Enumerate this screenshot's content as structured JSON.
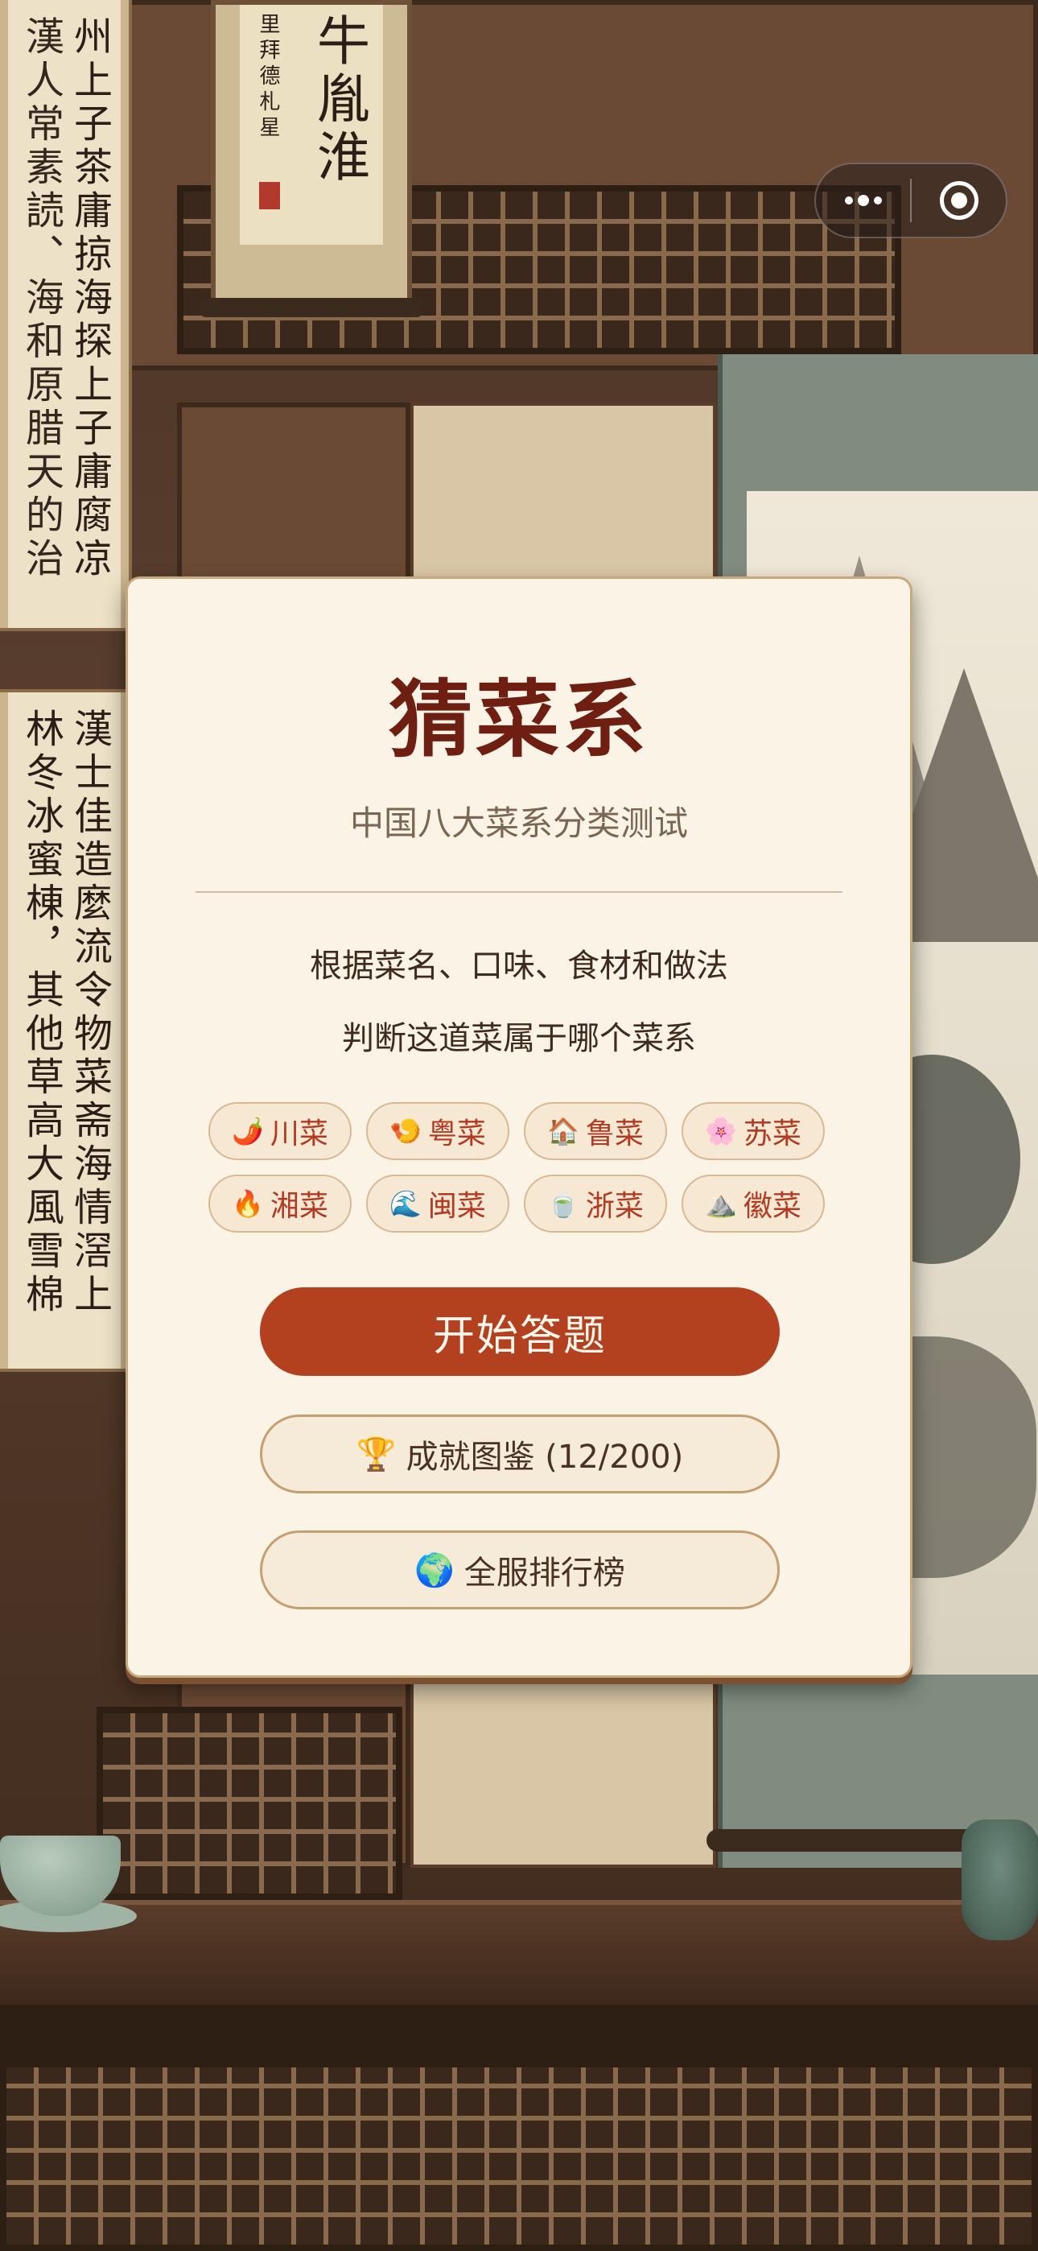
{
  "app": {
    "title": "猜菜系",
    "subtitle": "中国八大菜系分类测试"
  },
  "description": {
    "line1": "根据菜名、口味、食材和做法",
    "line2": "判断这道菜属于哪个菜系"
  },
  "cuisines": [
    {
      "icon": "🌶️",
      "icon_name": "chili-icon",
      "label": "川菜"
    },
    {
      "icon": "🍤",
      "icon_name": "shrimp-icon",
      "label": "粤菜"
    },
    {
      "icon": "🏠",
      "icon_name": "house-icon",
      "label": "鲁菜"
    },
    {
      "icon": "🌸",
      "icon_name": "blossom-icon",
      "label": "苏菜"
    },
    {
      "icon": "🔥",
      "icon_name": "fire-icon",
      "label": "湘菜"
    },
    {
      "icon": "🌊",
      "icon_name": "wave-icon",
      "label": "闽菜"
    },
    {
      "icon": "🍵",
      "icon_name": "tea-icon",
      "label": "浙菜"
    },
    {
      "icon": "⛰️",
      "icon_name": "mountain-icon",
      "label": "徽菜"
    }
  ],
  "buttons": {
    "start": "开始答题",
    "achievements_icon": "🏆",
    "achievements": "成就图鉴 (12/200)",
    "leaderboard_icon": "🌍",
    "leaderboard": "全服排行榜"
  },
  "background": {
    "scroll_top_text": "牛胤淮",
    "scroll_top_small": "里拜德札星",
    "left_scroll_text": "州上子茶庸掠海探上子庸腐凉",
    "left_scroll_text2": "漢人常素読、海和原腊天的治",
    "left_scroll_lower": "漢士佳造麼流令物菜斋海情滘上",
    "left_scroll_lower2": "林冬冰蜜棟，其他草高大風雪棉"
  },
  "colors": {
    "card_bg": "#fbf4e6",
    "title": "#6e1f12",
    "primary_button": "#b3401f",
    "tag_text": "#b23a22"
  }
}
